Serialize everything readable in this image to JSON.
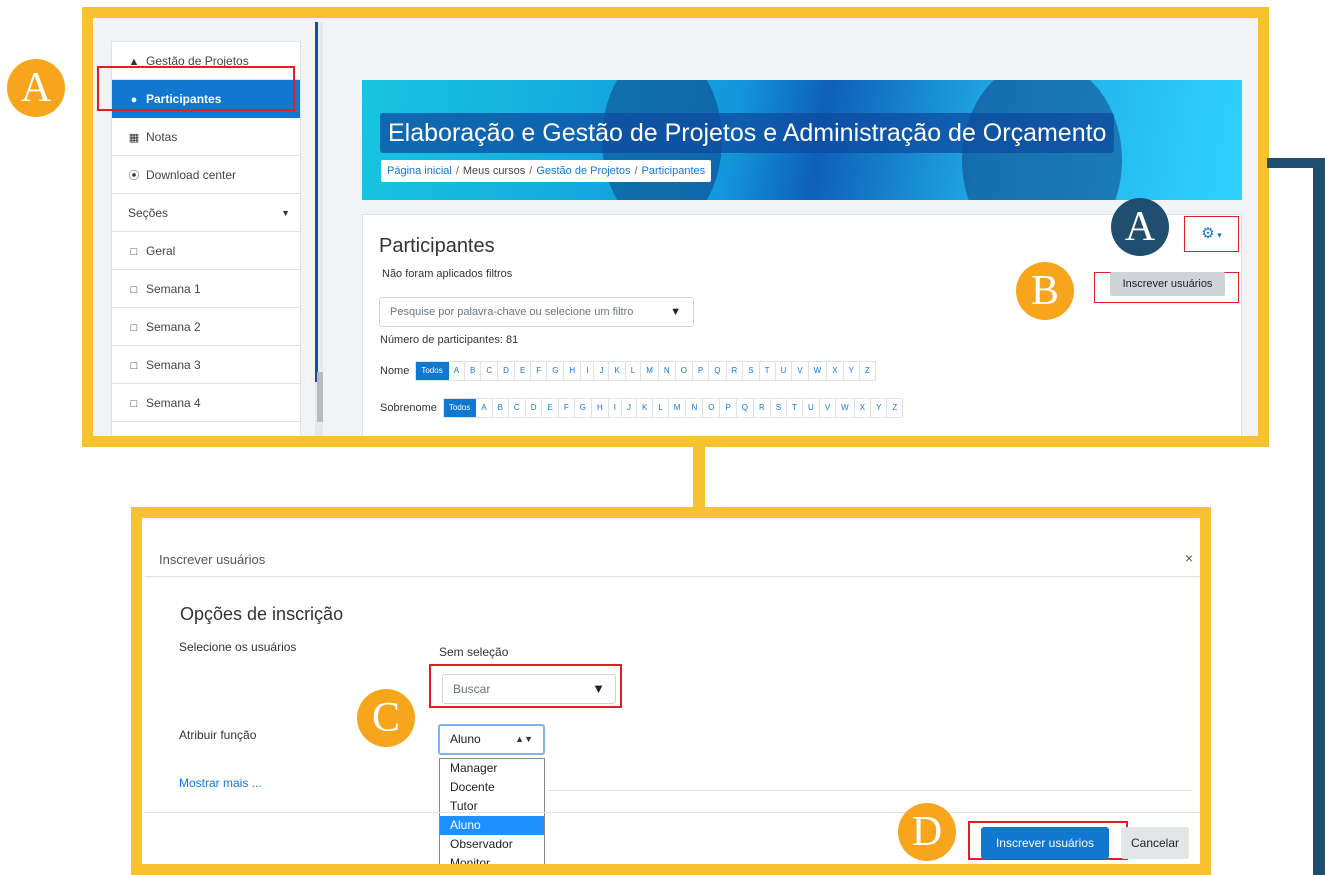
{
  "sidebar": {
    "items": [
      {
        "label": "Gestão de Projetos",
        "icon": "graduation-cap-icon"
      },
      {
        "label": "Participantes",
        "icon": "users-icon",
        "active": true
      },
      {
        "label": "Notas",
        "icon": "table-icon"
      },
      {
        "label": "Download center",
        "icon": "download-circle-icon"
      },
      {
        "label": "Seções",
        "icon": "caret-down-icon"
      },
      {
        "label": "Geral",
        "icon": "folder-icon"
      },
      {
        "label": "Semana 1",
        "icon": "folder-icon"
      },
      {
        "label": "Semana 2",
        "icon": "folder-icon"
      },
      {
        "label": "Semana 3",
        "icon": "folder-icon"
      },
      {
        "label": "Semana 4",
        "icon": "folder-icon"
      }
    ]
  },
  "course": {
    "title": "Elaboração e Gestão de Projetos e Administração de Orçamento",
    "breadcrumb": [
      "Página inicial",
      "Meus cursos",
      "Gestão de Projetos",
      "Participantes"
    ]
  },
  "participants": {
    "heading": "Participantes",
    "filters_note": "Não foram aplicados filtros",
    "filter_placeholder": "Pesquise por palavra-chave ou selecione um filtro",
    "count_text": "Número de participantes: 81",
    "first_name_label": "Nome",
    "last_name_label": "Sobrenome",
    "all_label": "Todos",
    "letters": [
      "A",
      "B",
      "C",
      "D",
      "E",
      "F",
      "G",
      "H",
      "I",
      "J",
      "K",
      "L",
      "M",
      "N",
      "O",
      "P",
      "Q",
      "R",
      "S",
      "T",
      "U",
      "V",
      "W",
      "X",
      "Y",
      "Z"
    ],
    "enroll_button": "Inscrever usuários"
  },
  "dialog": {
    "title": "Inscrever usuários",
    "close": "×",
    "options_heading": "Opções de inscrição",
    "select_users_label": "Selecione os usuários",
    "no_selection": "Sem seleção",
    "search_placeholder": "Buscar",
    "assign_role_label": "Atribuir função",
    "role_value": "Aluno",
    "role_options": [
      "Manager",
      "Docente",
      "Tutor",
      "Aluno",
      "Observador",
      "Monitor"
    ],
    "show_more": "Mostrar mais ...",
    "enroll_button": "Inscrever usuários",
    "cancel_button": "Cancelar"
  },
  "badges": {
    "sidebar": "A",
    "gear": "A",
    "enroll": "B",
    "role": "C",
    "submit": "D"
  },
  "colors": {
    "frame_yellow": "#f7c12f",
    "badge_orange": "#f6a51d",
    "badge_navy": "#1f4e6e",
    "moodle_blue": "#1177d1",
    "highlight_red": "#e02020"
  }
}
